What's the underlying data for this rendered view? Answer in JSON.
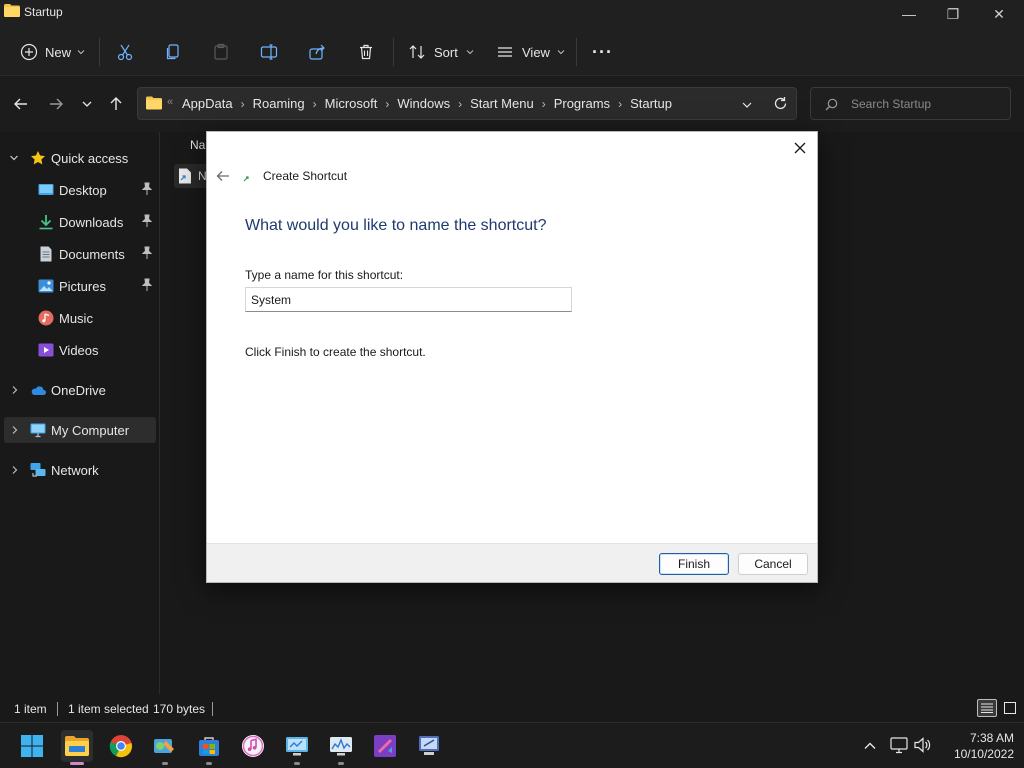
{
  "window": {
    "title": "Startup",
    "controls": {
      "minimize": "—",
      "maximize": "❐",
      "close": "✕"
    }
  },
  "toolbar": {
    "new_label": "New",
    "sort_label": "Sort",
    "view_label": "View",
    "more_label": "···"
  },
  "address": {
    "overflow": "«",
    "crumbs": [
      "AppData",
      "Roaming",
      "Microsoft",
      "Windows",
      "Start Menu",
      "Programs",
      "Startup"
    ],
    "sep": "›"
  },
  "search": {
    "placeholder": "Search Startup"
  },
  "navpane": {
    "quick_access": "Quick access",
    "items": [
      {
        "label": "Desktop",
        "icon": "desktop-icon",
        "pinned": true
      },
      {
        "label": "Downloads",
        "icon": "downloads-icon",
        "pinned": true
      },
      {
        "label": "Documents",
        "icon": "documents-icon",
        "pinned": true
      },
      {
        "label": "Pictures",
        "icon": "pictures-icon",
        "pinned": true
      },
      {
        "label": "Music",
        "icon": "music-icon",
        "pinned": false
      },
      {
        "label": "Videos",
        "icon": "videos-icon",
        "pinned": false
      }
    ],
    "onedrive": "OneDrive",
    "my_computer": "My Computer",
    "network": "Network"
  },
  "filearea": {
    "column_header_fragment": "Na",
    "file_fragment": "N"
  },
  "status": {
    "count": "1 item",
    "selected": "1 item selected",
    "size": "170 bytes"
  },
  "dialog": {
    "title": "Create Shortcut",
    "heading": "What would you like to name the shortcut?",
    "field_label": "Type a name for this shortcut:",
    "field_value": "System",
    "hint": "Click Finish to create the shortcut.",
    "finish_label": "Finish",
    "cancel_label": "Cancel"
  },
  "taskbar": {
    "time": "7:38 AM",
    "date": "10/10/2022",
    "apps": [
      "start-icon",
      "file-explorer-icon",
      "chrome-icon",
      "control-panel-icon",
      "microsoft-store-icon",
      "itunes-icon",
      "system-info-icon",
      "performance-monitor-icon",
      "visual-studio-icon",
      "remote-desktop-icon"
    ]
  },
  "colors": {
    "accent": "#0078d4",
    "dialog_heading": "#1e3a6e",
    "folder": "#f2c14e",
    "active_indicator": "#d088c6"
  }
}
